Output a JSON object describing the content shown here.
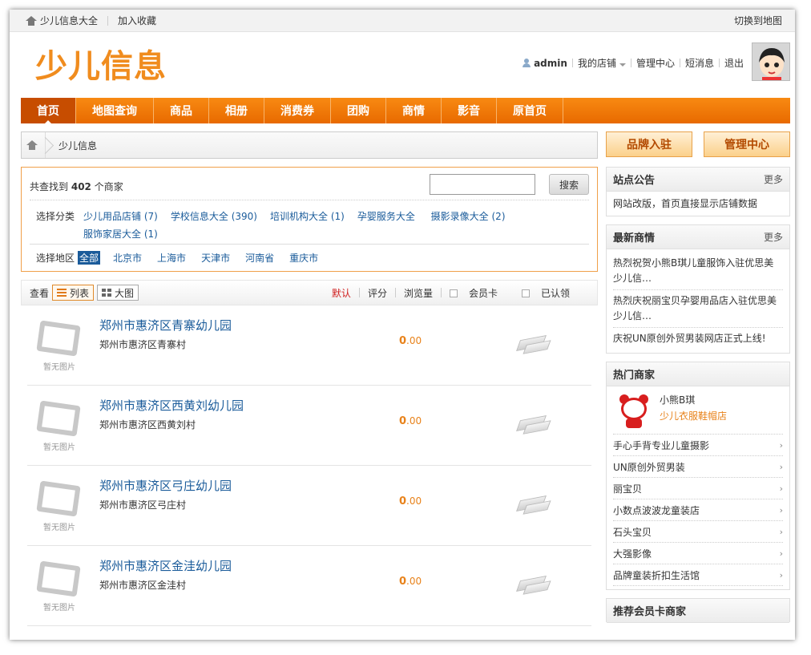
{
  "topbar": {
    "home_label": "少儿信息大全",
    "favorite_label": "加入收藏",
    "switch_map_label": "切换到地图"
  },
  "header": {
    "logo_text": "少儿信息",
    "username": "admin",
    "my_shop": "我的店铺",
    "manage_center": "管理中心",
    "messages": "短消息",
    "logout": "退出"
  },
  "nav": [
    {
      "label": "首页",
      "active": true
    },
    {
      "label": "地图查询"
    },
    {
      "label": "商品"
    },
    {
      "label": "相册"
    },
    {
      "label": "消费券"
    },
    {
      "label": "团购"
    },
    {
      "label": "商情"
    },
    {
      "label": "影音"
    },
    {
      "label": "原首页"
    }
  ],
  "breadcrumb": {
    "current": "少儿信息"
  },
  "filter": {
    "count_prefix": "共查找到",
    "count_value": "402",
    "count_suffix": "个商家",
    "search_placeholder": "",
    "search_button": "搜索",
    "category_label": "选择分类",
    "categories": [
      {
        "name": "少儿用品店铺",
        "count": "(7)"
      },
      {
        "name": "学校信息大全",
        "count": "(390)"
      },
      {
        "name": "培训机构大全",
        "count": "(1)"
      },
      {
        "name": "孕婴服务大全",
        "count": ""
      },
      {
        "name": "摄影录像大全",
        "count": "(2)"
      },
      {
        "name": "服饰家居大全",
        "count": "(1)"
      }
    ],
    "area_label": "选择地区",
    "areas": [
      {
        "name": "全部",
        "active": true
      },
      {
        "name": "北京市"
      },
      {
        "name": "上海市"
      },
      {
        "name": "天津市"
      },
      {
        "name": "河南省"
      },
      {
        "name": "重庆市"
      }
    ]
  },
  "viewbar": {
    "view_label": "查看",
    "list_label": "列表",
    "grid_label": "大图",
    "sort_default": "默认",
    "sort_rating": "评分",
    "sort_views": "浏览量",
    "filter_member": "会员卡",
    "filter_verified": "已认领"
  },
  "shops": [
    {
      "name": "郑州市惠济区青寨幼儿园",
      "address": "郑州市惠济区青寨村",
      "score_int": "0",
      "score_dec": ".00",
      "no_image": "暂无图片"
    },
    {
      "name": "郑州市惠济区西黄刘幼儿园",
      "address": "郑州市惠济区西黄刘村",
      "score_int": "0",
      "score_dec": ".00",
      "no_image": "暂无图片"
    },
    {
      "name": "郑州市惠济区弓庄幼儿园",
      "address": "郑州市惠济区弓庄村",
      "score_int": "0",
      "score_dec": ".00",
      "no_image": "暂无图片"
    },
    {
      "name": "郑州市惠济区金洼幼儿园",
      "address": "郑州市惠济区金洼村",
      "score_int": "0",
      "score_dec": ".00",
      "no_image": "暂无图片"
    }
  ],
  "sidebar": {
    "brand_button": "品牌入驻",
    "manage_button": "管理中心",
    "notice": {
      "title": "站点公告",
      "more": "更多",
      "items": [
        "网站改版，首页直接显示店铺数据"
      ]
    },
    "news": {
      "title": "最新商情",
      "more": "更多",
      "items": [
        "热烈祝贺小熊B琪儿童服饰入驻优思美少儿信…",
        "热烈庆祝丽宝贝孕婴用品店入驻优思美少儿信…",
        "庆祝UN原创外贸男装网店正式上线!"
      ]
    },
    "hot": {
      "title": "热门商家",
      "top_name": "小熊B琪",
      "top_category": "少儿衣服鞋帽店",
      "items": [
        "手心手背专业儿童摄影",
        "UN原创外贸男装",
        "丽宝贝",
        "小数点波波龙童装店",
        "石头宝贝",
        "大强影像",
        "品牌童装折扣生活馆"
      ]
    },
    "recommend": {
      "title": "推荐会员卡商家"
    }
  },
  "colors": {
    "accent": "#f08c1e",
    "nav": "#e86a00",
    "link": "#1a5b9a",
    "sort_active": "#d02020",
    "score": "#e8821a"
  }
}
